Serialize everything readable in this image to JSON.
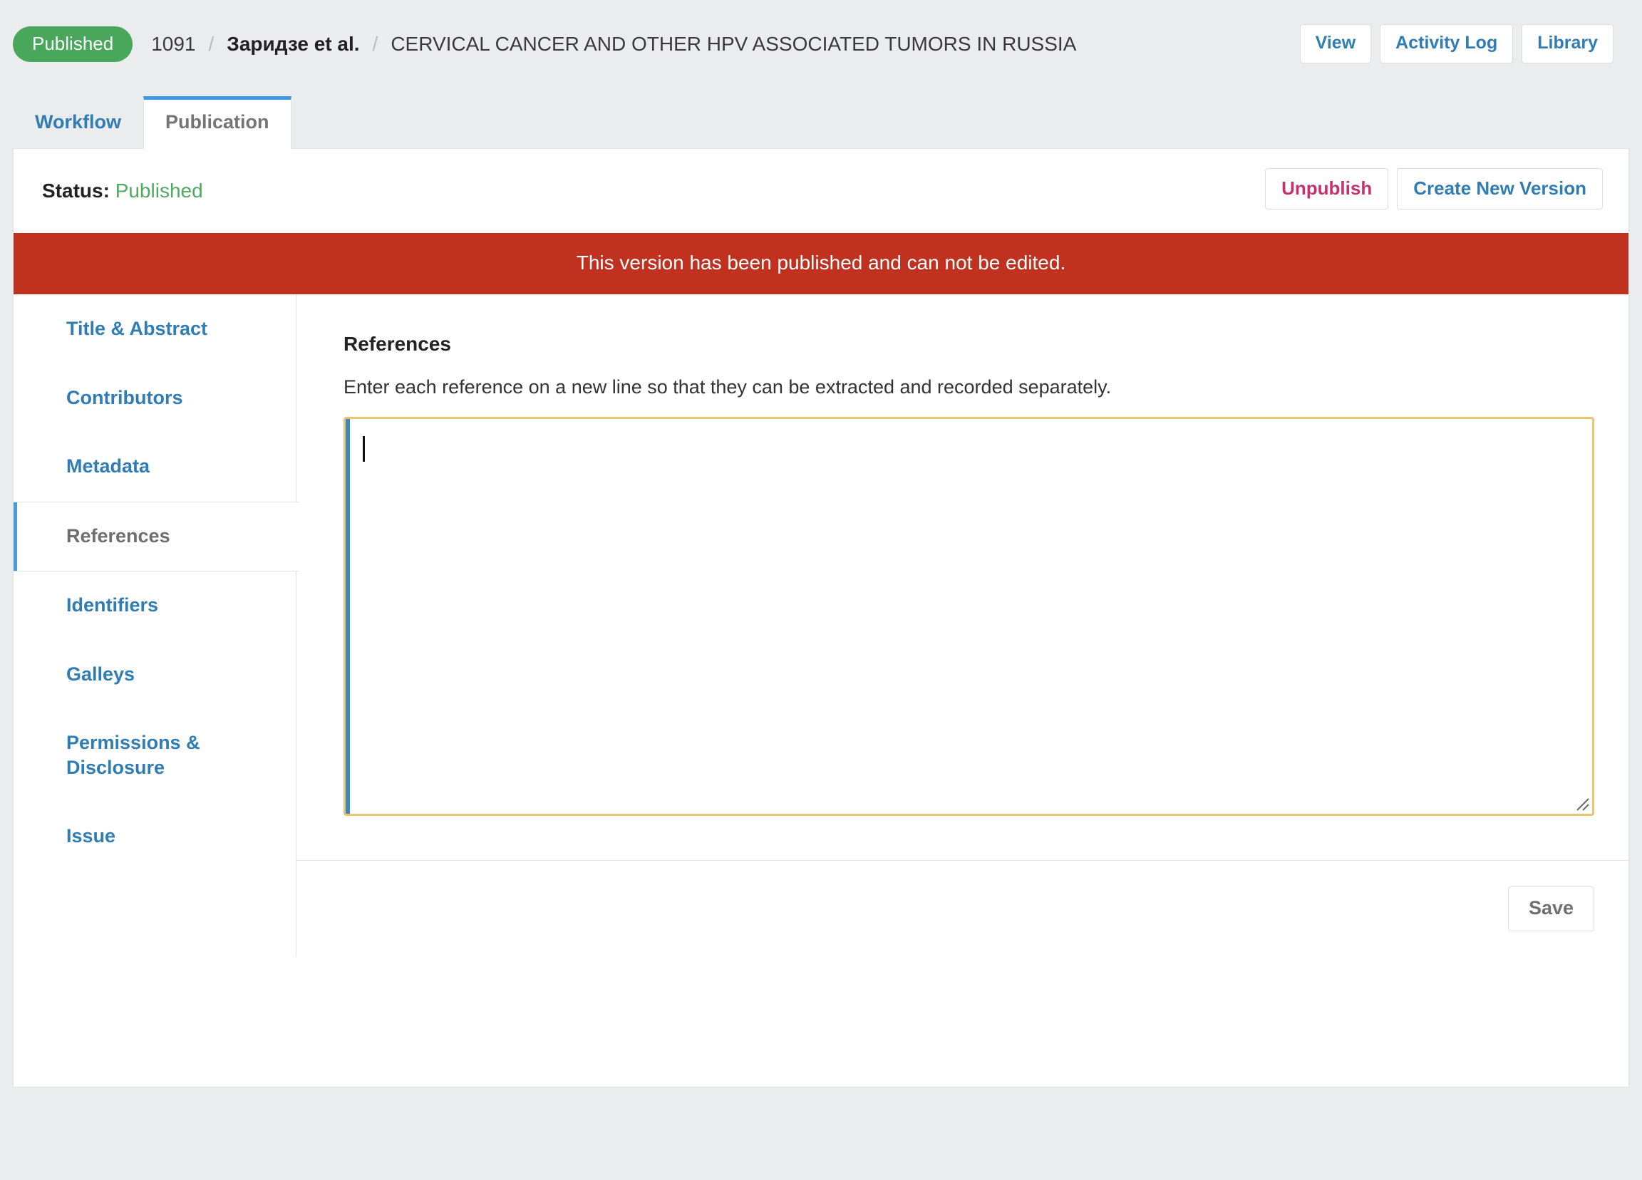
{
  "header": {
    "status_badge": "Published",
    "submission_id": "1091",
    "separator": "/",
    "authors": "Заридзе et al.",
    "title": "CERVICAL CANCER AND OTHER HPV ASSOCIATED TUMORS IN RUSSIA",
    "actions": [
      {
        "label": "View"
      },
      {
        "label": "Activity Log"
      },
      {
        "label": "Library"
      }
    ]
  },
  "tabs": [
    {
      "label": "Workflow",
      "active": false
    },
    {
      "label": "Publication",
      "active": true
    }
  ],
  "status": {
    "label": "Status:",
    "value": "Published",
    "actions": [
      {
        "label": "Unpublish",
        "style": "danger"
      },
      {
        "label": "Create New Version",
        "style": "primary"
      }
    ]
  },
  "alert": {
    "message": "This version has been published and can not be edited."
  },
  "sidebar": {
    "items": [
      {
        "label": "Title & Abstract",
        "active": false
      },
      {
        "label": "Contributors",
        "active": false
      },
      {
        "label": "Metadata",
        "active": false
      },
      {
        "label": "References",
        "active": true
      },
      {
        "label": "Identifiers",
        "active": false
      },
      {
        "label": "Galleys",
        "active": false
      },
      {
        "label": "Permissions & Disclosure",
        "active": false
      },
      {
        "label": "Issue",
        "active": false
      }
    ]
  },
  "main": {
    "field_title": "References",
    "field_description": "Enter each reference on a new line so that they can be extracted and recorded separately.",
    "textarea_value": "",
    "textarea_placeholder": "",
    "save_label": "Save"
  },
  "colors": {
    "accent_blue": "#2f7db3",
    "tab_blue": "#3d9ae2",
    "badge_green": "#49a75c",
    "status_green": "#4eaa5f",
    "alert_red": "#c0311f",
    "danger_pink": "#c8326c",
    "focus_gold": "#e8c572",
    "page_bg": "#ebecee"
  }
}
